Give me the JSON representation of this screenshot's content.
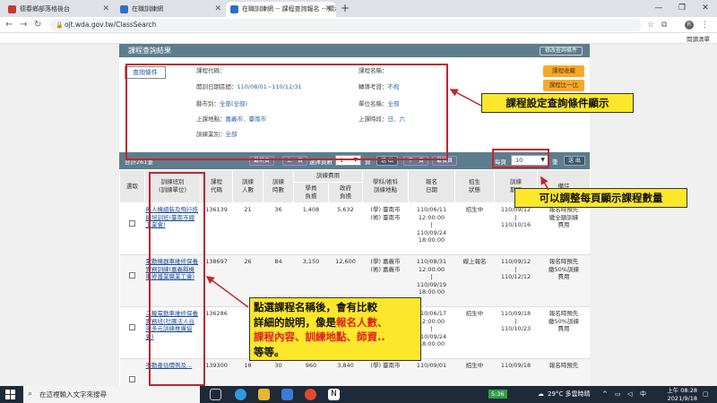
{
  "browser": {
    "tabs": [
      {
        "title": "德春鄉部落格後台",
        "active": false
      },
      {
        "title": "在職訓練網",
        "active": false
      },
      {
        "title": "在職訓練網 -- 課程查詢報名 -- 顯示...",
        "active": true
      }
    ],
    "url": "ojt.wda.gov.tw/ClassSearch",
    "reading_list": "閱讀清單",
    "avatar_letter": "R"
  },
  "header": {
    "title": "課程查詢結果",
    "right_button": "修改查詢條件"
  },
  "conditions": {
    "button": "查詢條件",
    "course_code_label": "課程代碼：",
    "date_label": "開訓日期區間：",
    "date_value": "110/08/01~110/12/31",
    "county_label": "縣市別：",
    "county_value": "全部(全部)",
    "location_label": "上課地點：",
    "location_value": "嘉義市．臺南市",
    "category_label": "訓練業別：",
    "category_value": "全部",
    "course_name_label": "課程名稱：",
    "transfer_label": "轉導考證：",
    "transfer_value": "不拘",
    "unit_label": "單位名稱：",
    "unit_value": "全部",
    "time_label": "上課時段：",
    "time_value": "日．六"
  },
  "side_buttons": {
    "collect": "課程收藏",
    "compare": "課程比一比"
  },
  "pager": {
    "total": "合計261筆",
    "first": "最前頁",
    "prev": "上一頁",
    "choose_page": "選擇頁數",
    "page_value": "1",
    "page_suffix": "頁",
    "go1": "送 出",
    "next": "下一頁",
    "last": "最後頁",
    "per_page": "每頁",
    "per_page_value": "10",
    "per_page_suffix": "筆",
    "go2": "送 出"
  },
  "table": {
    "group_header": "訓練費用",
    "headers": [
      "選取",
      "訓練班別\n(訓練單位)",
      "課程\n代碼",
      "訓練\n人數",
      "訓練\n時數",
      "學員\n負擔",
      "政府\n負擔",
      "學科/術科\n訓練地點",
      "報名\n日期",
      "招生\n狀態",
      "訓練\n期間",
      "備註"
    ],
    "rows": [
      {
        "name": "無人機組裝及飛行技能培訓班(臺南市總工業會)",
        "code": "136139",
        "people": "21",
        "hours": "36",
        "student": "1,408",
        "gov": "5,632",
        "place": "(學) 臺南市\n(術) 臺南市",
        "signup": "110/06/11\n12:00:00\n|\n110/09/24\n18:00:00",
        "status": "招生中",
        "period": "110/09/12\n|\n110/10/16",
        "note": "報名時預先\n繳全額訓練\n費用"
      },
      {
        "name": "電動機器車維修保養實務訓練(嘉義縣機車修護業職業工會)",
        "code": "138697",
        "people": "26",
        "hours": "84",
        "student": "3,150",
        "gov": "12,600",
        "place": "(學) 嘉義市\n(術) 嘉義市",
        "signup": "110/08/31\n12:00:00\n|\n110/09/19\n18:00:00",
        "status": "線上報名",
        "period": "110/09/12\n|\n110/12/12",
        "note": "報名時預先\n繳50%訓練\n費用"
      },
      {
        "name": "二輪電動車維修保養實務班(社團法人台灣多元訓練推廣協會)",
        "code": "136286",
        "people": "",
        "hours": "",
        "student": "",
        "gov": "",
        "place": "(學) 臺南市\n(術) 臺南市",
        "signup": "110/06/17\n12:00:00\n|\n110/09/24\n18:00:00",
        "status": "招生中",
        "period": "110/09/18\n|\n110/10/23",
        "note": "報名時預先\n繳50%訓練\n費用"
      },
      {
        "name": "不動產估價例及...",
        "code": "139300",
        "people": "18",
        "hours": "30",
        "student": "960",
        "gov": "3,840",
        "place": "(學) 臺南市",
        "signup": "110/09/01",
        "status": "招生中",
        "period": "110/09/18",
        "note": "報名時預先"
      }
    ]
  },
  "annotations": {
    "cond_callout": "課程設定查詢條件顯示",
    "perpage_callout": "可以調整每頁顯示課程數量",
    "detail_l1": "點選課程名稱後，會有比較",
    "detail_l2a": "詳細的說明，像是",
    "detail_l2b": "報名人數、",
    "detail_l3": "課程內容、訓練地點、師資..",
    "detail_l4": "等等。"
  },
  "taskbar": {
    "search_placeholder": "在這裡輸入文字來搜尋",
    "weather": "29°C 多雲時晴",
    "lang": "5:36",
    "time": "上午 08:28",
    "date": "2021/9/18"
  },
  "colors": {
    "accent": "#5d7d8d",
    "callout": "#fde72b",
    "highlight": "#c0262d"
  }
}
